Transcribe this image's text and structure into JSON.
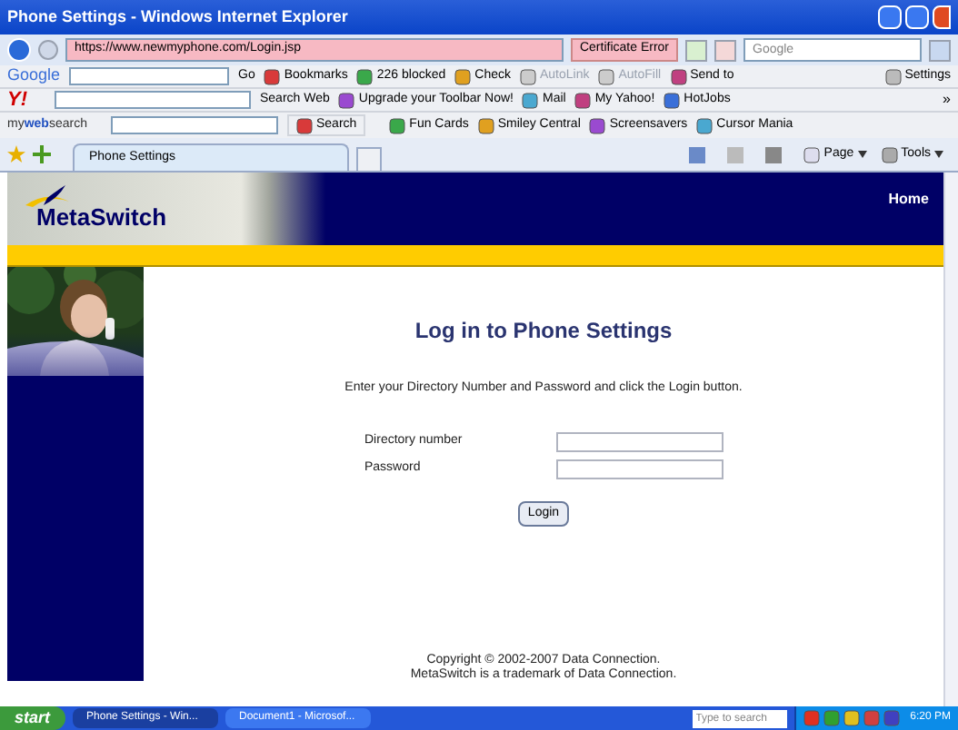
{
  "window": {
    "title": "Phone Settings - Windows Internet Explorer"
  },
  "address_bar": {
    "url": "https://www.newmyphone.com/Login.jsp",
    "certificate": "Certificate Error",
    "search_placeholder": "Google"
  },
  "google_toolbar": {
    "logo": "Google",
    "items": [
      {
        "label": "Go",
        "disabled": false
      },
      {
        "label": "Bookmarks",
        "disabled": false
      },
      {
        "label": "226 blocked",
        "disabled": false
      },
      {
        "label": "Check",
        "disabled": false
      },
      {
        "label": "AutoLink",
        "disabled": true
      },
      {
        "label": "AutoFill",
        "disabled": true
      },
      {
        "label": "Send to",
        "disabled": false
      }
    ],
    "settings": "Settings"
  },
  "yahoo_toolbar": {
    "logo": "Y!",
    "items": [
      "Search Web",
      "Upgrade your Toolbar Now!",
      "Mail",
      "My Yahoo!",
      "HotJobs"
    ],
    "more": "»"
  },
  "mywebsearch_toolbar": {
    "logo": "my**web**search",
    "items": [
      "Search",
      "Fun Cards",
      "Smiley Central",
      "Screensavers",
      "Cursor Mania"
    ]
  },
  "tabs": [
    {
      "label": "Phone Settings",
      "selected": true
    }
  ],
  "command_bar": [
    "Page",
    "Tools"
  ],
  "page": {
    "nav": "Home",
    "logo": "MetaSwitch",
    "heading": "Log in to Phone Settings",
    "instructions": "Enter your Directory Number and Password and click the Login button.",
    "fields": [
      {
        "label": "Directory number"
      },
      {
        "label": "Password"
      }
    ],
    "button": "Login",
    "footer": [
      "Copyright © 2002-2007 Data Connection.",
      "MetaSwitch is a trademark of Data Connection."
    ]
  },
  "taskbar": {
    "start": "start",
    "tasks": [
      {
        "label": "Phone Settings - Win...",
        "selected": true
      },
      {
        "label": "Document1 - Microsof...",
        "selected": false
      }
    ],
    "search_placeholder": "Type to search",
    "clock": "6:20 PM"
  }
}
